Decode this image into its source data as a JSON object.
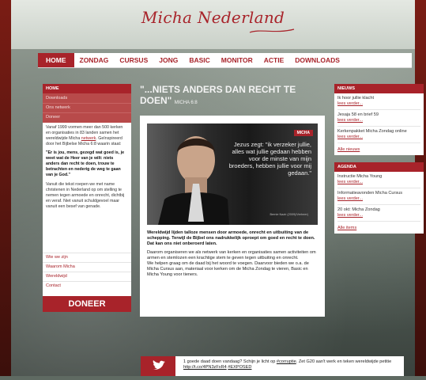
{
  "logo": "Micha Nederland",
  "nav": [
    "HOME",
    "ZONDAG",
    "CURSUS",
    "JONG",
    "BASIC",
    "MONITOR",
    "ACTIE",
    "DOWNLOADS"
  ],
  "left": {
    "header": "HOME",
    "menu": [
      "Downloads",
      "Ons netwerk",
      "Doneer"
    ],
    "intro_before": "Vanaf 1999 vormen meer dan 500 kerken en organisaties in 83 landen samen het wereldwijde Micha ",
    "intro_link": "netwerk",
    "intro_after": ". Geïnspireerd door het Bijbelse Micha 6:8 waarin staat:",
    "quote": "\"Er is jou, mens, gezegd wat goed is, je weet wat de Heer van je wilt: niets anders dan recht te doen, trouw te betrachten en nederig de weg te gaan van je God.\"",
    "text2": "Vanuit die tekst roepen we met name christenen in Nederland op om stelling te nemen tegen armoede en onrecht, dichtbij en veraf. Niet vanuit schuldgevoel maar vanuit een besef van genade.",
    "links": [
      "Wie we zijn",
      "Waarom Micha",
      "Wereldwijd",
      "Contact"
    ],
    "doneer": "DONEER"
  },
  "center": {
    "title": "\"...NIETS ANDERS DAN RECHT TE DOEN\"",
    "title_small": "MICHA 6:8",
    "badge": "MICHA",
    "quote": "Jezus zegt: \"ik verzeker jullie, alles wat jullie gedaan hebben voor de minste van mijn broeders, hebben jullie voor mij gedaan.\"",
    "quote_source": "Bernie Nazir (2009)/Verheer)",
    "body_bold": "Wereldwijd lijden talloze mensen door armoede, onrecht en uitbuiting van de schepping. Terwijl de Bijbel ons nadrukkelijk oproept om goed en recht te doen. Dat kan ons niet onberoerd laten.",
    "body_normal": "Daarom organiseren we als netwerk van kerken en organisaties samen activiteiten om armen en stemlozen een krachtige stem te geven tegen uitbuiting en onrecht.\nWe helpen graag om de daad bij het woord te voegen. Daarvoor bieden we o.a. de Micha Cursus aan, materiaal voor kerken om de Micha Zondag te vieren, Basic en  Micha Young voor tieners."
  },
  "right": {
    "news_header": "NIEUWS",
    "news": [
      {
        "title": "Ik hoor jullie klacht",
        "more": "lees verder..."
      },
      {
        "title": "Jesaja 58 en brief 59",
        "more": "lees verder..."
      },
      {
        "title": "Kerkenpakket Micha Zondag online",
        "more": "lees verder..."
      }
    ],
    "news_all": "Alle nieuws",
    "agenda_header": "AGENDA",
    "agenda": [
      {
        "title": "Instructie Micha Young",
        "more": "lees verder..."
      },
      {
        "title": "Informatieavonden Micha Cursus",
        "more": "lees verder..."
      },
      {
        "title": "20 okt: Micha Zondag",
        "more": "lees verder..."
      }
    ],
    "agenda_all": "Alle items"
  },
  "twitter": {
    "before": "1 goede daad doen vandaag? Schijn je licht op ",
    "hashtag": "#corruptie",
    "middle": ". Zet G20 aan't werk en teken wereldwijde petitie ",
    "url": "http://t.co/4PN3zFxR4",
    "tag2": "#EXPOSED"
  },
  "colors": {
    "accent": "#a8232a",
    "text": "#333333"
  }
}
